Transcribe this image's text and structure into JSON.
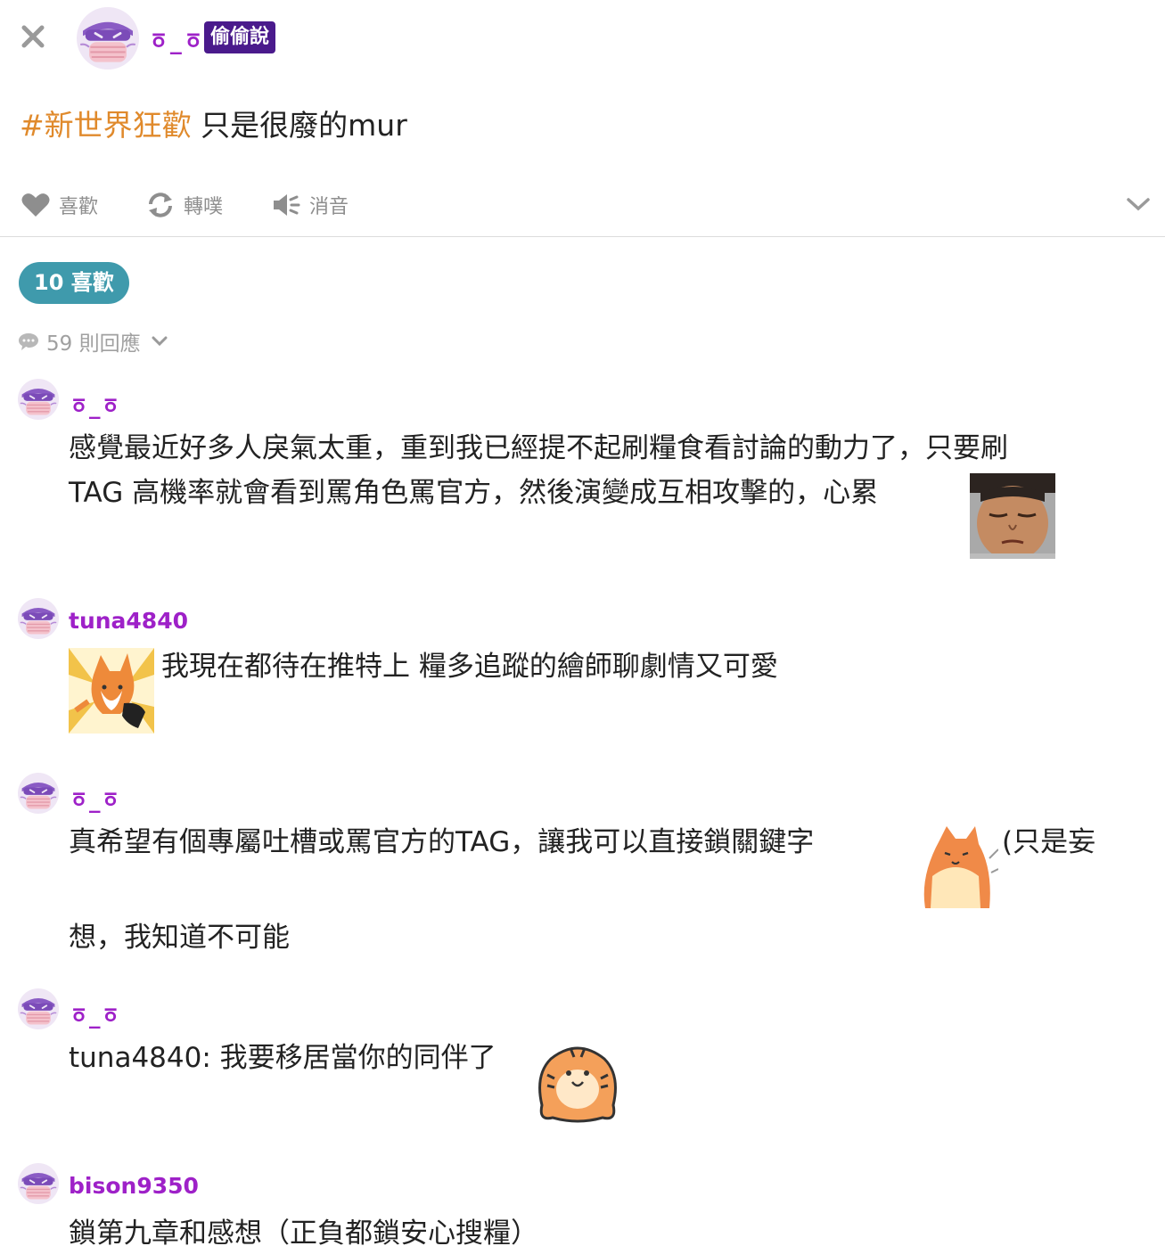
{
  "header": {
    "close_icon": "close-icon",
    "op_name": "ㆆ_ㆆ",
    "badge": "偷偷說"
  },
  "post": {
    "hashtag": "#新世界狂歡",
    "text": " 只是很廢的mur"
  },
  "actions": {
    "like": "喜歡",
    "replurk": "轉噗",
    "mute": "消音"
  },
  "likes": {
    "label": "10 喜歡"
  },
  "replies": {
    "label": "59 則回應"
  },
  "responses": [
    {
      "name": "ㆆ_ㆆ",
      "line1": "感覺最近好多人戾氣太重，重到我已經提不起刷糧食看討論的動力了，只要刷",
      "line2": "TAG 高機率就會看到罵角色罵官方，然後演變成互相攻擊的，心累"
    },
    {
      "name": "tuna4840",
      "text": "我現在都待在推特上 糧多追蹤的繪師聊劇情又可愛"
    },
    {
      "name": "ㆆ_ㆆ",
      "line1": "真希望有個專屬吐槽或罵官方的TAG，讓我可以直接鎖關鍵字",
      "line1b": "(只是妄",
      "line2": "想，我知道不可能"
    },
    {
      "name": "ㆆ_ㆆ",
      "text": "tuna4840: 我要移居當你的同伴了"
    },
    {
      "name": "bison9350",
      "text": "鎖第九章和感想（正負都鎖安心搜糧）"
    }
  ],
  "colors": {
    "username": "#9e21c8",
    "hashtag": "#e08a2c",
    "badge_bg": "#4a1a8c",
    "likes_pill": "#3f9aac",
    "muted_gray": "#8e8e8e"
  }
}
